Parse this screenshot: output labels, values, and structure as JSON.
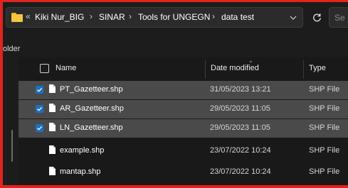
{
  "address_bar": {
    "overflow": "«",
    "breadcrumbs": [
      "Kiki Nur_BIG",
      "SINAR",
      "Tools for UNGEGN",
      "data test"
    ],
    "separator": "›"
  },
  "search": {
    "placeholder": "Se"
  },
  "nav": {
    "label": "older"
  },
  "columns": {
    "name": "Name",
    "date": "Date modified",
    "type": "Type"
  },
  "files": [
    {
      "name": "PT_Gazetteer.shp",
      "date": "31/05/2023 13:21",
      "type": "SHP File",
      "selected": true
    },
    {
      "name": "AR_Gazetteer.shp",
      "date": "29/05/2023 11:05",
      "type": "SHP File",
      "selected": true
    },
    {
      "name": "LN_Gazetteer.shp",
      "date": "29/05/2023 11:05",
      "type": "SHP File",
      "selected": true
    },
    {
      "name": "example.shp",
      "date": "23/07/2022 10:24",
      "type": "SHP File",
      "selected": false
    },
    {
      "name": "mantap.shp",
      "date": "23/07/2022 10:24",
      "type": "SHP File",
      "selected": false
    }
  ],
  "colors": {
    "highlight_frame": "#e0241f",
    "checkbox": "#1f6fc0",
    "selected_row": "#4a4a4a"
  },
  "icons": [
    "folder-icon",
    "dropdown-chevron-icon",
    "refresh-icon",
    "file-icon",
    "checkmark-icon"
  ]
}
